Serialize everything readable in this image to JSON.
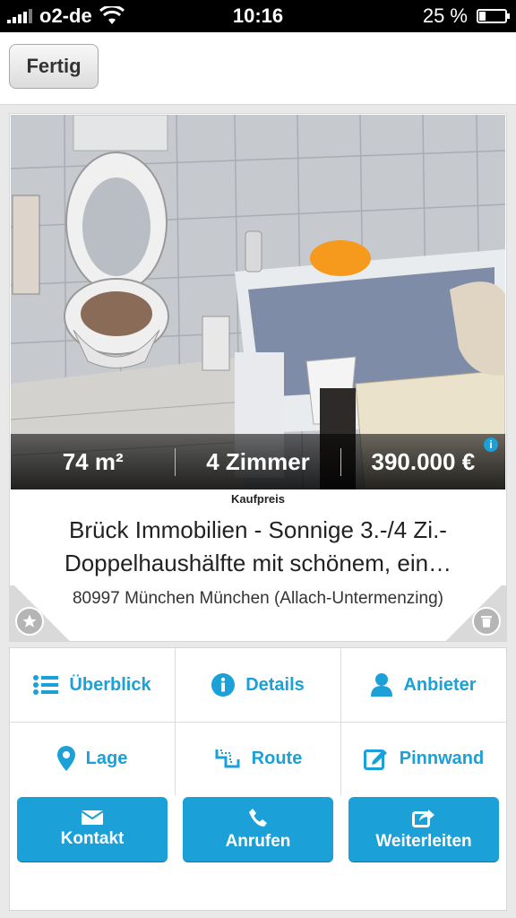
{
  "status_bar": {
    "carrier": "o2-de",
    "time": "10:16",
    "battery_text": "25 %",
    "battery_level": 0.25
  },
  "header": {
    "done_label": "Fertig"
  },
  "listing": {
    "area": "74 m²",
    "rooms": "4 Zimmer",
    "price": "390.000 €",
    "price_caption": "Kaufpreis",
    "title": "Brück Immobilien - Sonnige 3.-/4 Zi.-Doppelhaushälfte mit schönem, ein…",
    "address": "80997 München München (Allach-Untermenzing)"
  },
  "menu": {
    "overview": "Überblick",
    "details": "Details",
    "provider": "Anbieter",
    "location": "Lage",
    "route": "Route",
    "pinboard": "Pinnwand"
  },
  "actions": {
    "contact": "Kontakt",
    "call": "Anrufen",
    "forward": "Weiterleiten"
  },
  "colors": {
    "accent": "#1ca0d8",
    "background": "#e9e9e9"
  },
  "icons": [
    "signal-icon",
    "wifi-icon",
    "battery-icon",
    "info-icon",
    "star-icon",
    "trash-icon",
    "list-icon",
    "details-info-icon",
    "person-icon",
    "location-pin-icon",
    "route-icon",
    "edit-icon",
    "mail-icon",
    "phone-icon",
    "share-icon"
  ]
}
